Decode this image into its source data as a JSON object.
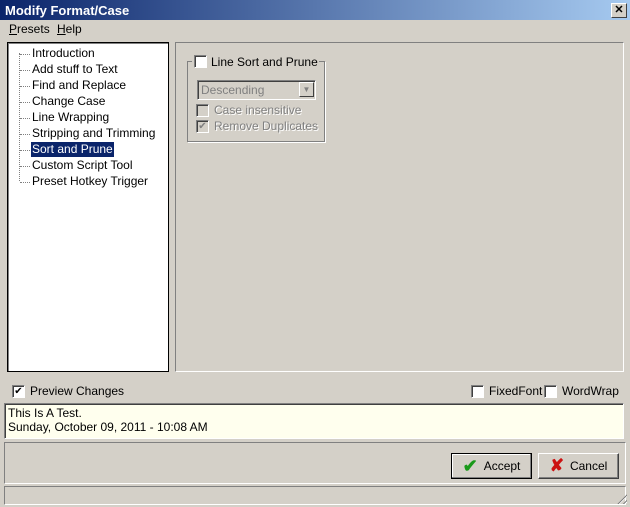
{
  "window": {
    "title": "Modify Format/Case",
    "close": "✕"
  },
  "menu": [
    {
      "label": "Presets",
      "accel": "P",
      "rest": "resets"
    },
    {
      "label": "Help",
      "accel": "H",
      "rest": "elp"
    }
  ],
  "tree": {
    "items": [
      "Introduction",
      "Add stuff to Text",
      "Find and Replace",
      "Change Case",
      "Line Wrapping",
      "Stripping and Trimming",
      "Sort and Prune",
      "Custom Script Tool",
      "Preset Hotkey Trigger"
    ],
    "selected": "Sort and Prune"
  },
  "sort_panel": {
    "enable_label": "Line Sort and Prune",
    "enabled": false,
    "order_value": "Descending",
    "case_insensitive_label": "Case insensitive",
    "case_insensitive": false,
    "remove_duplicates_label": "Remove Duplicates",
    "remove_duplicates": true
  },
  "options": {
    "preview_label": "Preview Changes",
    "preview": true,
    "fixedfont_label": "FixedFont",
    "fixedfont": false,
    "wordwrap_label": "WordWrap",
    "wordwrap": false
  },
  "preview": {
    "lines": [
      "This Is A Test.",
      "Sunday, October 09, 2011 - 10:08 AM"
    ]
  },
  "buttons": {
    "accept": "Accept",
    "cancel": "Cancel"
  },
  "colors": {
    "accept_icon": "#1a9a1a",
    "cancel_icon": "#cc1111",
    "selection": "#0a246a"
  }
}
